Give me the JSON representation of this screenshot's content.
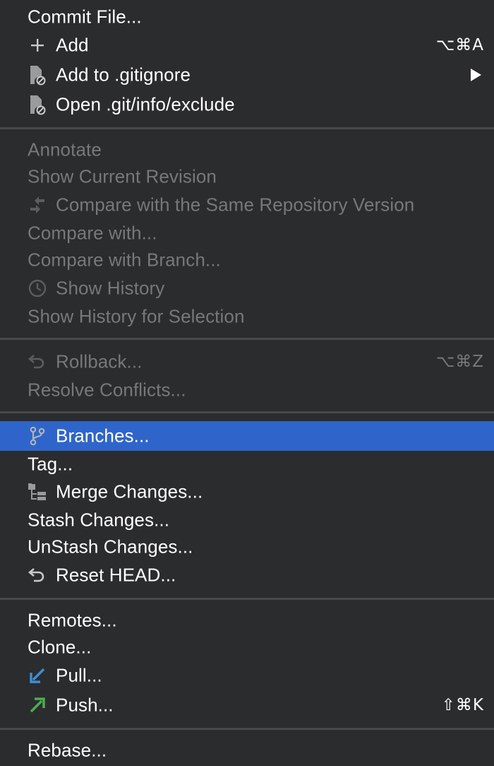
{
  "menu": {
    "items": [
      {
        "label": "Commit File..."
      },
      {
        "label": "Add",
        "shortcut": "⌥⌘A",
        "icon": "plus-icon"
      },
      {
        "label": "Add to .gitignore",
        "icon": "ignore-file-icon"
      },
      {
        "label": "Open .git/info/exclude",
        "icon": "ignore-file-icon"
      },
      {
        "label": "Annotate"
      },
      {
        "label": "Show Current Revision"
      },
      {
        "label": "Compare with the Same Repository Version",
        "icon": "compare-icon"
      },
      {
        "label": "Compare with..."
      },
      {
        "label": "Compare with Branch..."
      },
      {
        "label": "Show History",
        "icon": "history-clock-icon"
      },
      {
        "label": "Show History for Selection"
      },
      {
        "label": "Rollback...",
        "shortcut": "⌥⌘Z",
        "icon": "rollback-icon"
      },
      {
        "label": "Resolve Conflicts..."
      },
      {
        "label": "Branches...",
        "icon": "branch-icon"
      },
      {
        "label": "Tag..."
      },
      {
        "label": "Merge Changes...",
        "icon": "merge-icon"
      },
      {
        "label": "Stash Changes..."
      },
      {
        "label": "UnStash Changes..."
      },
      {
        "label": "Reset HEAD...",
        "icon": "reset-icon"
      },
      {
        "label": "Remotes..."
      },
      {
        "label": "Clone..."
      },
      {
        "label": "Pull...",
        "icon": "pull-arrow-icon"
      },
      {
        "label": "Push...",
        "shortcut": "⇧⌘K",
        "icon": "push-arrow-icon"
      },
      {
        "label": "Rebase..."
      }
    ]
  },
  "colors": {
    "background": "#2b2c2e",
    "text": "#ffffff",
    "disabled_text": "#77787a",
    "selection": "#2f65ca",
    "separator": "#48494c",
    "pull_icon": "#3d8fd6",
    "push_icon": "#4caf50"
  }
}
